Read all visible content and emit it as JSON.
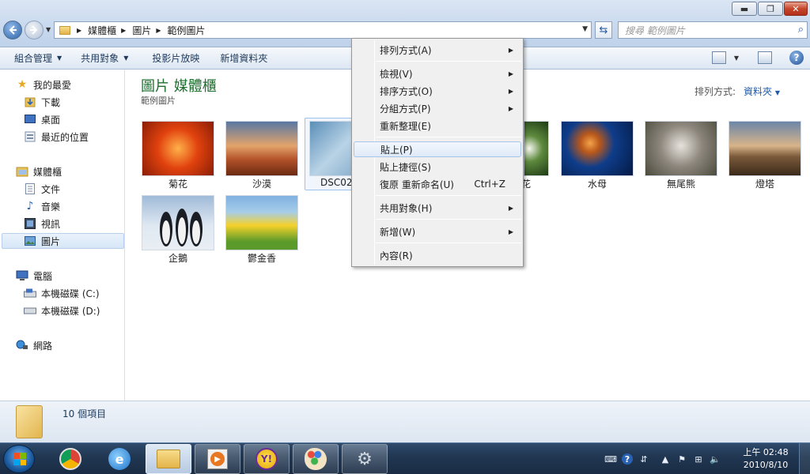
{
  "window": {
    "controls": {
      "minimize": "▬",
      "maximize": "❐",
      "close": "✕"
    }
  },
  "address": {
    "crumbs": [
      "媒體櫃",
      "圖片",
      "範例圖片"
    ],
    "search_placeholder": "搜尋 範例圖片"
  },
  "toolbar": {
    "organize": "組合管理",
    "share": "共用對象",
    "slideshow": "投影片放映",
    "new_folder": "新增資料夾"
  },
  "sidebar": {
    "favorites": "我的最愛",
    "downloads": "下載",
    "desktop": "桌面",
    "recent": "最近的位置",
    "libraries": "媒體櫃",
    "documents": "文件",
    "music": "音樂",
    "videos": "視訊",
    "pictures": "圖片",
    "computer": "電腦",
    "drive_c": "本機磁碟 (C:)",
    "drive_d": "本機磁碟 (D:)",
    "network": "網路"
  },
  "main": {
    "title": "圖片 媒體櫃",
    "subtitle": "範例圖片",
    "arrange_label": "排列方式:",
    "arrange_value": "資料夾",
    "items": [
      {
        "label": "菊花"
      },
      {
        "label": "沙漠"
      },
      {
        "label": "DSC02"
      },
      {
        "label": "花"
      },
      {
        "label": "水母"
      },
      {
        "label": "無尾熊"
      },
      {
        "label": "燈塔"
      },
      {
        "label": "企鵝"
      },
      {
        "label": "鬱金香"
      }
    ]
  },
  "details": {
    "count": "10 個項目"
  },
  "context_menu": {
    "arrange": "排列方式(A)",
    "view": "檢視(V)",
    "sort": "排序方式(O)",
    "group": "分組方式(P)",
    "refresh": "重新整理(E)",
    "paste": "貼上(P)",
    "paste_shortcut": "貼上捷徑(S)",
    "undo_rename": "復原 重新命名(U)",
    "undo_key": "Ctrl+Z",
    "share": "共用對象(H)",
    "new": "新增(W)",
    "properties": "內容(R)"
  },
  "taskbar": {
    "time": "上午 02:48",
    "date": "2010/8/10"
  }
}
